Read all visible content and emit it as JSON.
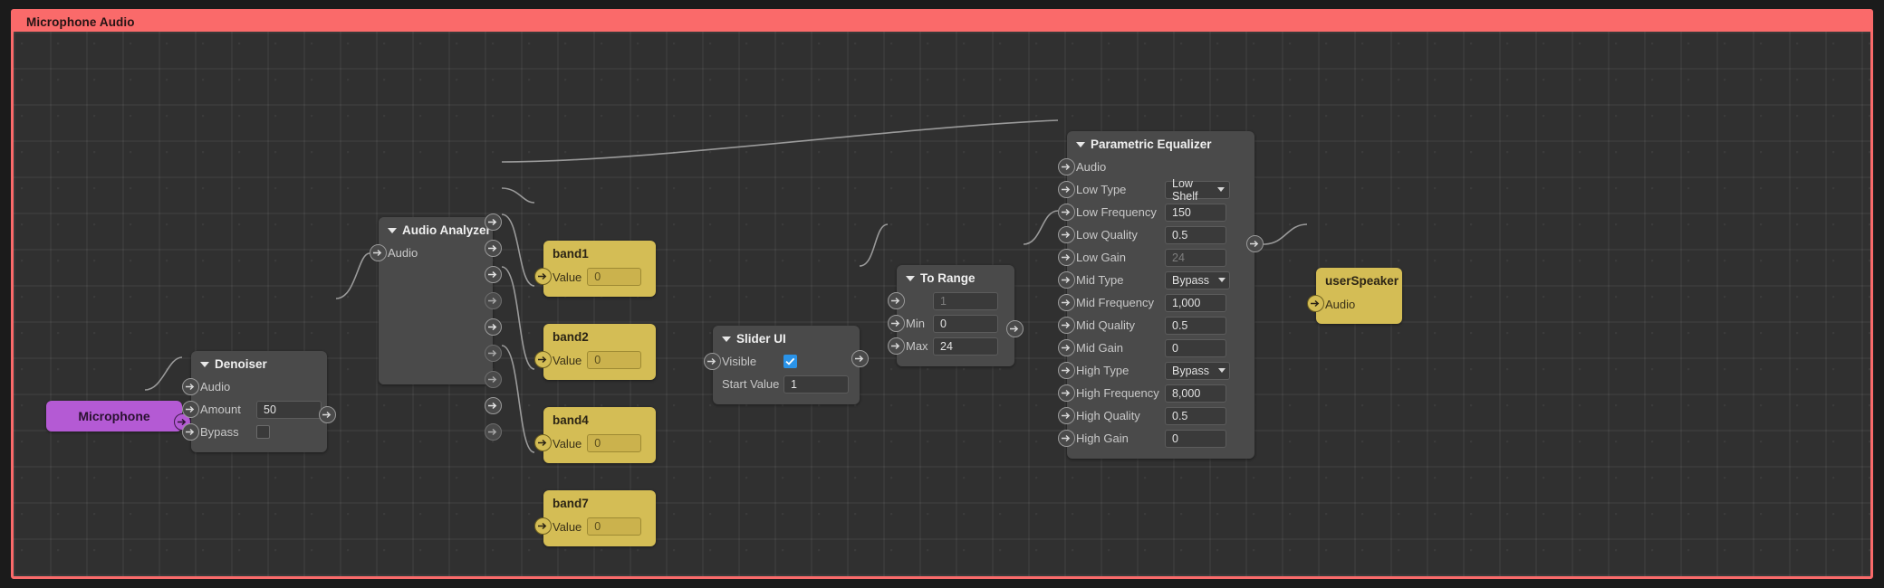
{
  "window": {
    "title": "Microphone Audio"
  },
  "colors": {
    "header_bg": "#fa6a6a",
    "canvas_bg": "#303030",
    "node_gray": "#4a4a4a",
    "node_gold": "#d4bd55",
    "node_purple": "#b45ad4",
    "checkbox_checked": "#2a93e8",
    "wire": "#b9b9b9"
  },
  "nodes": {
    "microphone": {
      "title": "Microphone",
      "outputs": [
        "audio-out"
      ]
    },
    "denoiser": {
      "title": "Denoiser",
      "rows": [
        {
          "label": "Audio",
          "type": "port-only"
        },
        {
          "label": "Amount",
          "type": "number",
          "value": "50"
        },
        {
          "label": "Bypass",
          "type": "checkbox",
          "checked": false
        }
      ]
    },
    "audio_analyzer": {
      "title": "Audio Analyzer",
      "input_label": "Audio",
      "output_count": 9
    },
    "band1": {
      "title": "band1",
      "value_label": "Value",
      "value": "0"
    },
    "band2": {
      "title": "band2",
      "value_label": "Value",
      "value": "0"
    },
    "band4": {
      "title": "band4",
      "value_label": "Value",
      "value": "0"
    },
    "band7": {
      "title": "band7",
      "value_label": "Value",
      "value": "0"
    },
    "slider_ui": {
      "title": "Slider UI",
      "rows": [
        {
          "label": "Visible",
          "type": "checkbox",
          "checked": true
        },
        {
          "label": "Start Value",
          "type": "number",
          "value": "1"
        }
      ]
    },
    "to_range": {
      "title": "To Range",
      "rows": [
        {
          "label": "",
          "type": "number",
          "value": "1",
          "muted": true
        },
        {
          "label": "Min",
          "type": "number",
          "value": "0",
          "muted": false
        },
        {
          "label": "Max",
          "type": "number",
          "value": "24",
          "muted": false
        }
      ]
    },
    "parametric_equalizer": {
      "title": "Parametric Equalizer",
      "rows": [
        {
          "label": "Audio",
          "type": "port-only"
        },
        {
          "label": "Low Type",
          "type": "select",
          "value": "Low Shelf"
        },
        {
          "label": "Low Frequency",
          "type": "number",
          "value": "150"
        },
        {
          "label": "Low Quality",
          "type": "number",
          "value": "0.5"
        },
        {
          "label": "Low Gain",
          "type": "number",
          "value": "24",
          "muted": true
        },
        {
          "label": "Mid Type",
          "type": "select",
          "value": "Bypass"
        },
        {
          "label": "Mid Frequency",
          "type": "number",
          "value": "1,000"
        },
        {
          "label": "Mid Quality",
          "type": "number",
          "value": "0.5"
        },
        {
          "label": "Mid Gain",
          "type": "number",
          "value": "0"
        },
        {
          "label": "High Type",
          "type": "select",
          "value": "Bypass"
        },
        {
          "label": "High Frequency",
          "type": "number",
          "value": "8,000"
        },
        {
          "label": "High Quality",
          "type": "number",
          "value": "0.5"
        },
        {
          "label": "High Gain",
          "type": "number",
          "value": "0"
        }
      ]
    },
    "user_speaker": {
      "title": "userSpeaker",
      "input_label": "Audio"
    }
  }
}
